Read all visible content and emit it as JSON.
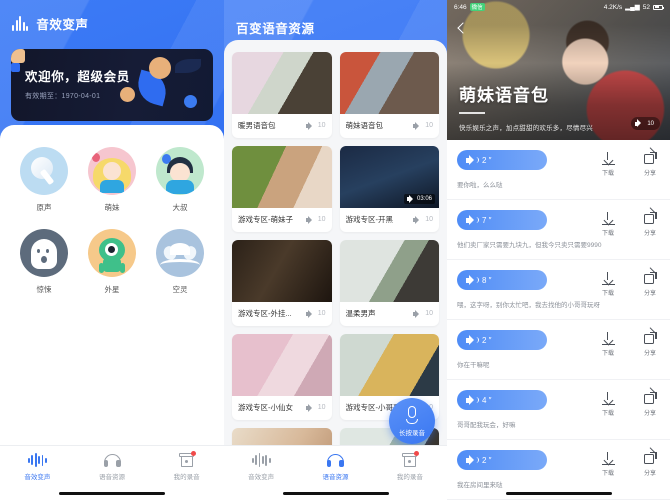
{
  "panel1": {
    "app_title": "音效变声",
    "vip_card": {
      "title": "欢迎你，超级会员",
      "expiry": "有效期至：1970-04-01"
    },
    "voices": [
      {
        "label": "原声",
        "icon": "microphone-icon"
      },
      {
        "label": "萌妹",
        "icon": "girl-avatar-icon"
      },
      {
        "label": "大叔",
        "icon": "man-avatar-icon"
      },
      {
        "label": "惊悚",
        "icon": "ghost-icon"
      },
      {
        "label": "外星",
        "icon": "alien-icon"
      },
      {
        "label": "空灵",
        "icon": "lotus-icon"
      }
    ],
    "tabs": [
      {
        "label": "音效变声",
        "icon": "waveform-icon",
        "active": true
      },
      {
        "label": "语音资源",
        "icon": "headphones-icon",
        "active": false
      },
      {
        "label": "我的录音",
        "icon": "archive-box-icon",
        "active": false,
        "badge": true
      }
    ]
  },
  "panel2": {
    "app_title": "百变语音资源",
    "cards": [
      {
        "title": "暖男语音包",
        "count": "10",
        "thumb": "t1"
      },
      {
        "title": "萌妹语音包",
        "count": "10",
        "thumb": "t2"
      },
      {
        "title": "游戏专区-萌妹子",
        "count": "10",
        "thumb": "t3"
      },
      {
        "title": "游戏专区-开黑",
        "count": "10",
        "thumb": "t4",
        "badge": "03:06"
      },
      {
        "title": "游戏专区-外挂...",
        "count": "10",
        "thumb": "t5"
      },
      {
        "title": "温柔男声",
        "count": "10",
        "thumb": "t6"
      },
      {
        "title": "游戏专区-小仙女",
        "count": "10",
        "thumb": "t7"
      },
      {
        "title": "游戏专区-小哥哥",
        "count": "10",
        "thumb": "t8"
      },
      {
        "title": "",
        "count": "",
        "thumb": "t9"
      },
      {
        "title": "",
        "count": "",
        "thumb": "t10"
      }
    ],
    "record_button": {
      "label": "长按录音",
      "icon": "microphone-icon"
    },
    "tabs": [
      {
        "label": "音效变声",
        "icon": "waveform-icon",
        "active": false
      },
      {
        "label": "语音资源",
        "icon": "headphones-icon",
        "active": true
      },
      {
        "label": "我的录音",
        "icon": "archive-box-icon",
        "active": false,
        "badge": true
      }
    ]
  },
  "panel3": {
    "status_bar": {
      "time": "6:46",
      "carrier_chip": "微信",
      "network": "4.2K/s",
      "battery": "52"
    },
    "back_icon": "back-chevron-icon",
    "hero": {
      "title": "萌妹语音包",
      "subtitle": "快乐娱乐之声，加点甜甜的欢乐多，尽情尽兴",
      "play_count": "10",
      "play_icon": "speaker-icon"
    },
    "actions": {
      "download": "下载",
      "share": "分享"
    },
    "voice_list": [
      {
        "duration": "2 ″",
        "text": "要你啦，么么哒"
      },
      {
        "duration": "7 ″",
        "text": "他们卖厂家只需要九块九，但我今只卖只需要9990"
      },
      {
        "duration": "8 ″",
        "text": "喂，这字呀，别你太忙吧，我去找他的小哥哥玩呀"
      },
      {
        "duration": "2 ″",
        "text": "你在干嘛呢"
      },
      {
        "duration": "4 ″",
        "text": "哥哥配我玩会，好嘛"
      },
      {
        "duration": "2 ″",
        "text": "我在房间里来哒"
      }
    ]
  },
  "colors": {
    "brand": "#3a77f1",
    "pill": "#4f8cf6",
    "badge": "#f04a4a",
    "dark_card": "#12162a"
  }
}
